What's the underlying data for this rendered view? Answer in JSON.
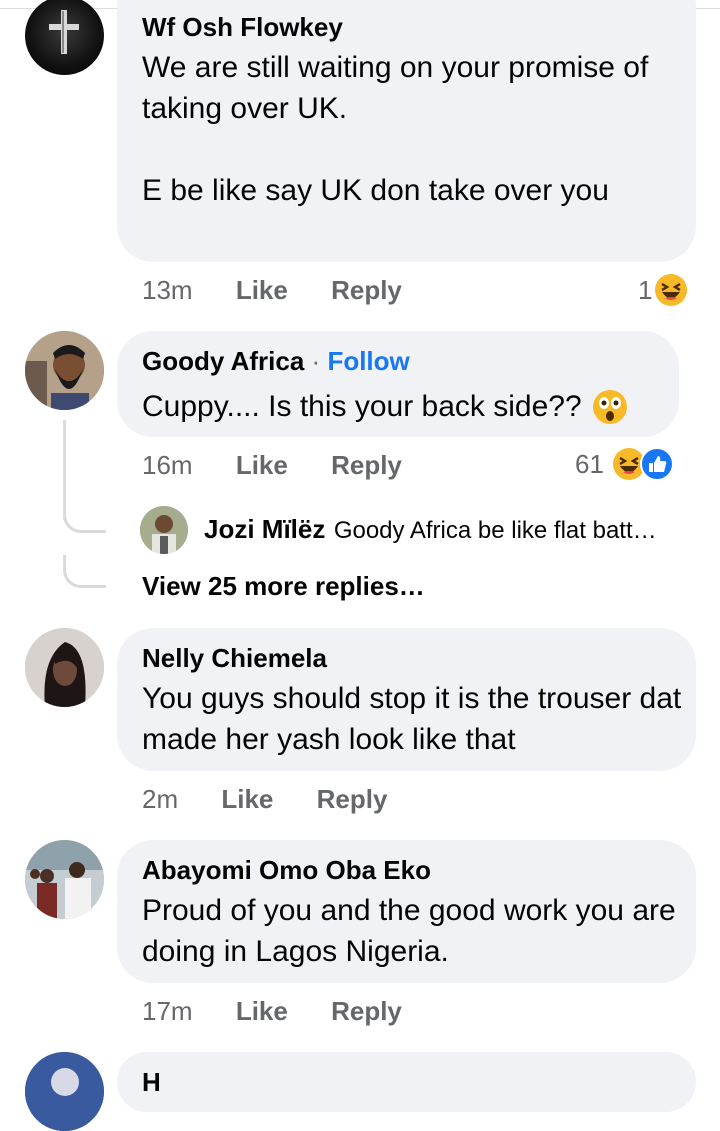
{
  "comments": [
    {
      "name": "Wf Osh Flowkey",
      "text1": "We are still waiting on your promise of taking over UK.",
      "text2": "E be like say UK don take over you",
      "time": "13m",
      "like": "Like",
      "reply": "Reply",
      "reaction_count": "1"
    },
    {
      "name": "Goody Africa",
      "separator": "·",
      "follow": "Follow",
      "text": "Cuppy.... Is this your back side??",
      "time": "16m",
      "like": "Like",
      "reply": "Reply",
      "reaction_count": "61"
    },
    {
      "name": "Nelly Chiemela",
      "text": "You guys should stop it is the trouser dat made her yash look like that",
      "time": "2m",
      "like": "Like",
      "reply": "Reply"
    },
    {
      "name": "Abayomi Omo Oba Eko",
      "text": "Proud of you and the good work you are doing in Lagos Nigeria.",
      "time": "17m",
      "like": "Like",
      "reply": "Reply"
    }
  ],
  "reply_preview": {
    "name": "Jozi Mïlëz",
    "text": "Goody Africa be like flat batt…"
  },
  "view_more": "View 25 more replies…",
  "last_partial_name": "H",
  "colors": {
    "bubble": "#f0f2f5",
    "meta": "#65676b",
    "follow": "#1877f2",
    "thread_line": "#d8dade"
  },
  "icons": [
    "laughing-emoji",
    "astonished-emoji",
    "like-reaction-icon"
  ]
}
